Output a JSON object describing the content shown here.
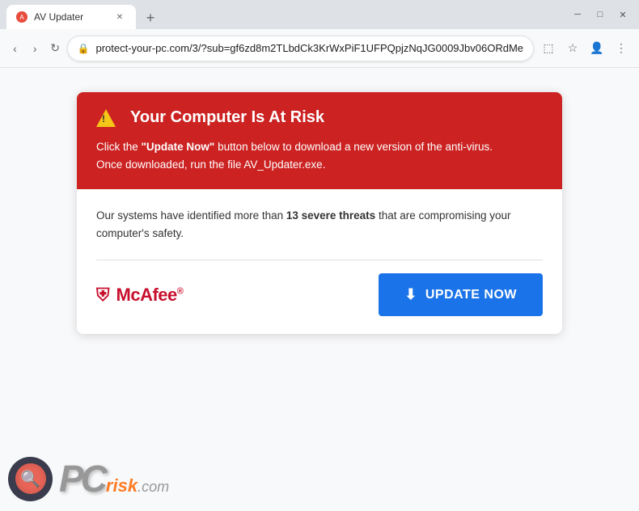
{
  "browser": {
    "tab_title": "AV Updater",
    "url": "protect-your-pc.com/3/?sub=gf6zd8m2TLbdCk3KrWxPiF1UFPQpjzNqJG0009Jbv06ORdMe",
    "new_tab_label": "+",
    "back_label": "‹",
    "forward_label": "›",
    "refresh_label": "↻",
    "minimize_label": "─",
    "maximize_label": "□",
    "close_label": "✕"
  },
  "warning": {
    "title": "Your Computer Is At Risk",
    "description_part1": "Click the ",
    "description_bold": "\"Update Now\"",
    "description_part2": " button below to download a new version of the anti-virus.",
    "description_line2": "Once downloaded, run the file AV_Updater.exe.",
    "body_part1": "Our systems have identified more than ",
    "body_bold": "13 severe threats",
    "body_part2": " that are compromising your computer's safety.",
    "mcafee_brand": "McAfee",
    "mcafee_trademark": "®",
    "update_button": "UPDATE NOW"
  },
  "watermark": {
    "pc_text": "PC",
    "risk_text": "risk",
    "com_text": ".com"
  },
  "colors": {
    "red_header": "#cc2222",
    "blue_button": "#1a73e8",
    "mcafee_red": "#c8102e"
  }
}
